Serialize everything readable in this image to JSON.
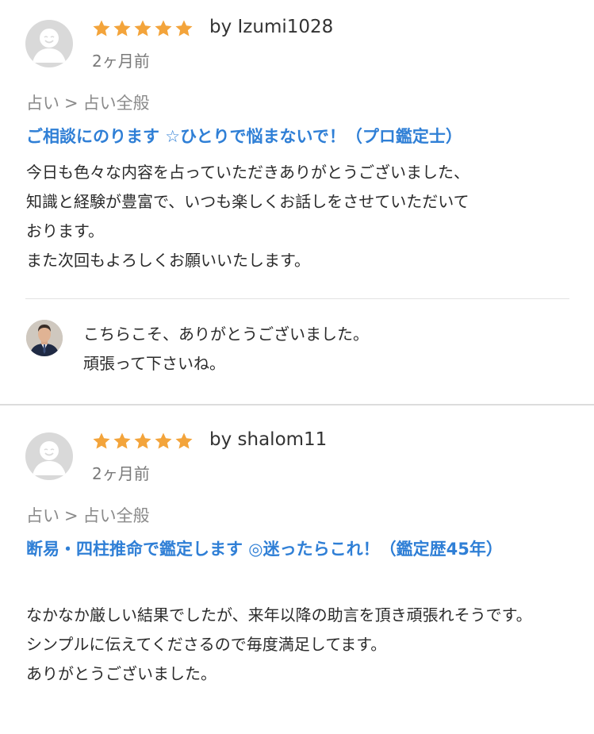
{
  "colors": {
    "star": "#f3a43b",
    "service_title": "#2f7fd6",
    "meta_text": "#8a8a8a",
    "avatar_bg": "#d9d9d9"
  },
  "reviews": [
    {
      "rating": 5,
      "username": "by Izumi1028",
      "date": "2ヶ月前",
      "category": {
        "parent": "占い",
        "separator": ">",
        "child": "占い全般"
      },
      "service_title": "ご相談にのります ☆ひとりで悩まないで！（プロ鑑定士）",
      "comment": {
        "lines": [
          "今日も色々な内容を占っていただきありがとうございました、",
          "知識と経験が豊富で、いつも楽しくお話しをさせていただいて",
          "おります。",
          "また次回もよろしくお願いいたします。"
        ]
      },
      "reply": {
        "lines": [
          "こちらこそ、ありがとうございました。",
          "頑張って下さいね。"
        ]
      }
    },
    {
      "rating": 5,
      "username": "by shalom11",
      "date": "2ヶ月前",
      "category": {
        "parent": "占い",
        "separator": ">",
        "child": "占い全般"
      },
      "service_title": "断易・四柱推命で鑑定します ◎迷ったらこれ！（鑑定歴45年）",
      "comment": {
        "lines": [
          "なかなか厳しい結果でしたが、来年以降の助言を頂き頑張れそうです。",
          "シンプルに伝えてくださるので毎度満足してます。",
          "ありがとうございました。"
        ]
      }
    }
  ]
}
